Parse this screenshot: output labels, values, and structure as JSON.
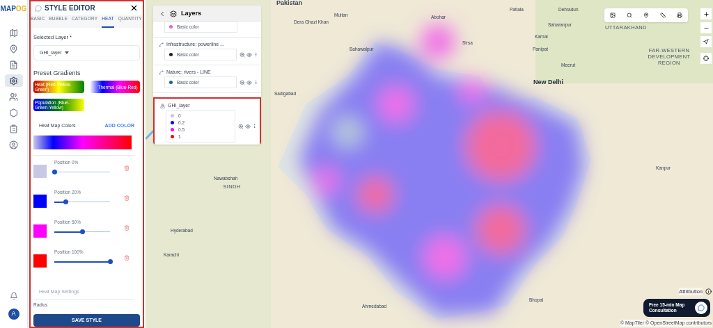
{
  "logo": {
    "main": "MAP",
    "accent": "OG"
  },
  "nav_items": [
    {
      "selected": false
    },
    {
      "selected": false
    },
    {
      "selected": false
    },
    {
      "selected": true
    },
    {
      "selected": false
    },
    {
      "selected": false
    },
    {
      "selected": false
    },
    {
      "selected": false
    }
  ],
  "user_avatar": {
    "initial": "A"
  },
  "style_editor": {
    "title": "STYLE EDITOR",
    "highlighted": true,
    "tabs": [
      {
        "label": "BASIC",
        "selected": false
      },
      {
        "label": "BUBBLE",
        "selected": false
      },
      {
        "label": "CATEGORY",
        "selected": false
      },
      {
        "label": "HEAT",
        "selected": true
      },
      {
        "label": "QUANTITY",
        "selected": false
      }
    ],
    "selected_layer": {
      "label": "Selected Layer *",
      "value": "GHI_layer"
    },
    "preset_title": "Preset Gradients",
    "presets": [
      {
        "label": "Heat (Red-Yellow-Green)"
      },
      {
        "label": "Thermal (Blue-Red)"
      },
      {
        "label": "Population (Blue-Green-Yellow)"
      }
    ],
    "colors_title": "Heat Map Colors",
    "add_color": "ADD COLOR",
    "stops": [
      {
        "color": "#c8c8e6",
        "label": "Position 0%",
        "level": 0
      },
      {
        "color": "#0000ff",
        "label": "Position 20%",
        "level": 0.2
      },
      {
        "color": "#ff00ff",
        "label": "Position 50%",
        "level": 0.5
      },
      {
        "color": "#ff0000",
        "label": "Position 100%",
        "level": 1
      }
    ],
    "settings_title": "Heat Map Settings",
    "radius_label": "Radius",
    "save": "SAVE STYLE"
  },
  "layers_panel": {
    "title": "Layers",
    "layers": [
      {
        "kind": "partial",
        "highlighted": false,
        "legend": [
          {
            "color": "#dd66cc",
            "label": "Basic color"
          }
        ]
      },
      {
        "kind": "line",
        "name": "Infrastructure: powerline ...",
        "highlighted": false,
        "legend": [
          {
            "color": "#222222",
            "label": "Basic color"
          }
        ]
      },
      {
        "kind": "line",
        "name": "Nature: rivers - LINE",
        "highlighted": false,
        "legend": [
          {
            "color": "#1f5fa0",
            "label": "Basic color"
          }
        ]
      },
      {
        "kind": "point",
        "name": "GHI_layer",
        "highlighted": true,
        "legend": [
          {
            "color": "#c8c8e6",
            "label": "0"
          },
          {
            "color": "#0000ff",
            "label": "0.2"
          },
          {
            "color": "#ff00ff",
            "label": "0.5"
          },
          {
            "color": "#ff0000",
            "label": "1"
          }
        ]
      }
    ]
  },
  "map": {
    "labels": [
      {
        "text": "Pakistan",
        "kind": "country"
      },
      {
        "text": "Patiala",
        "kind": "city"
      },
      {
        "text": "Dehradun",
        "kind": "city"
      },
      {
        "text": "Multan",
        "kind": "city"
      },
      {
        "text": "Abohar",
        "kind": "city"
      },
      {
        "text": "Dera Ghazi Khan",
        "kind": "city"
      },
      {
        "text": "UTTARAKHAND",
        "kind": "region"
      },
      {
        "text": "Saharanpur",
        "kind": "city"
      },
      {
        "text": "Karnal",
        "kind": "city"
      },
      {
        "text": "Sirsa",
        "kind": "city"
      },
      {
        "text": "Bahawalpur",
        "kind": "city"
      },
      {
        "text": "Panipat",
        "kind": "city"
      },
      {
        "text": "FAR-WESTERN DEVELOPMENT REGION",
        "kind": "region"
      },
      {
        "text": "Meerut",
        "kind": "city"
      },
      {
        "text": "New Delhi",
        "kind": "capital"
      },
      {
        "text": "Sadigabad",
        "kind": "city"
      },
      {
        "text": "Kanpur",
        "kind": "city"
      },
      {
        "text": "Nawabshah",
        "kind": "city"
      },
      {
        "text": "SINDH",
        "kind": "region"
      },
      {
        "text": "Hyderabad",
        "kind": "city"
      },
      {
        "text": "Karachi",
        "kind": "city"
      },
      {
        "text": "Bhopal",
        "kind": "city"
      },
      {
        "text": "Ahmedabad",
        "kind": "city"
      }
    ],
    "attribution": "Attribution",
    "consult": "Free 15-min Map Consultation",
    "credits": "© MapTiler © OpenStreetMap contributors"
  }
}
